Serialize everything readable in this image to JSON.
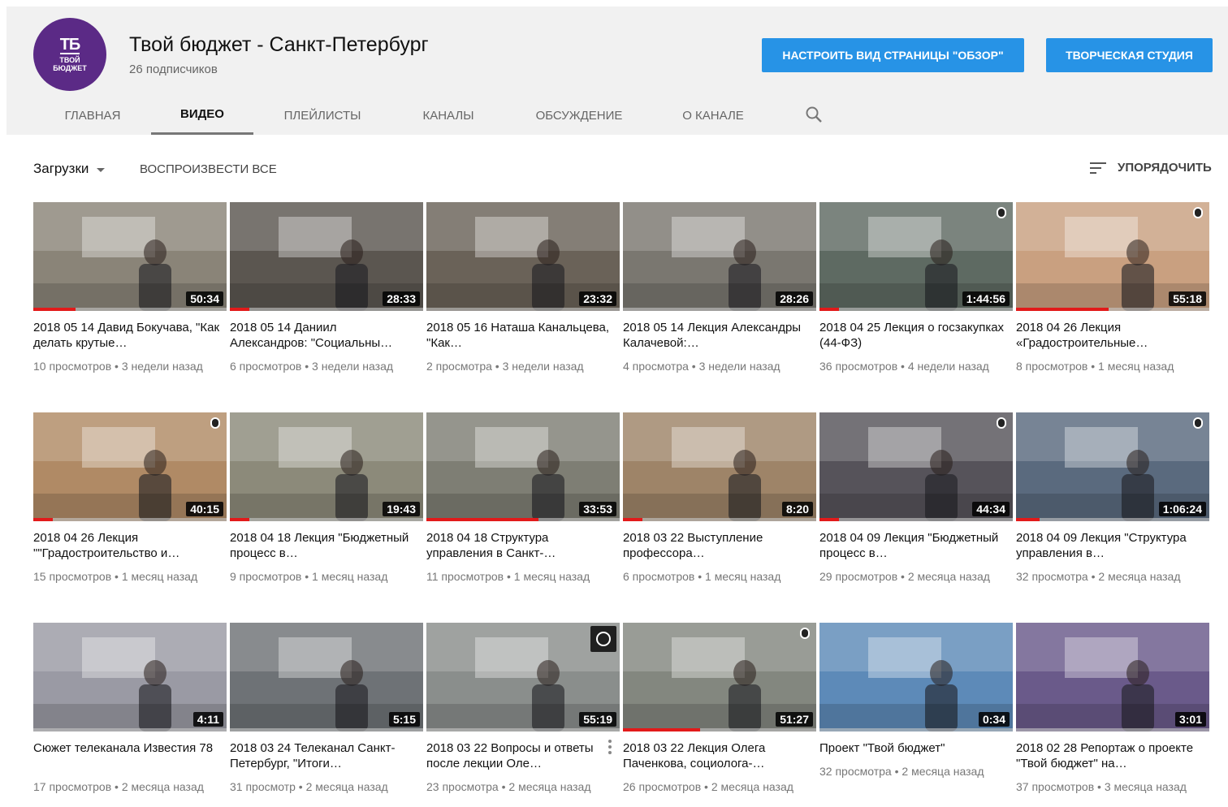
{
  "channel": {
    "title": "Твой бюджет - Санкт-Петербург",
    "subscribers": "26 подписчиков",
    "logo_line1": "TБ",
    "logo_line2": "ТВОЙ",
    "logo_line3": "БЮДЖЕТ",
    "customize_label": "НАСТРОИТЬ ВИД СТРАНИЦЫ \"ОБЗОР\"",
    "studio_label": "ТВОРЧЕСКАЯ СТУДИЯ"
  },
  "tabs": [
    {
      "label": "ГЛАВНАЯ"
    },
    {
      "label": "ВИДЕО"
    },
    {
      "label": "ПЛЕЙЛИСТЫ"
    },
    {
      "label": "КАНАЛЫ"
    },
    {
      "label": "ОБСУЖДЕНИЕ"
    },
    {
      "label": "О КАНАЛЕ"
    }
  ],
  "toolbar": {
    "uploads_label": "Загрузки",
    "play_all_label": "ВОСПРОИЗВЕСТИ ВСЕ",
    "sort_label": "УПОРЯДОЧИТЬ"
  },
  "colors": {
    "accent": "#2793e6",
    "progress": "#e21a1a",
    "brand": "#5b2a86"
  },
  "videos": [
    {
      "title": "2018 05 14 Давид Бокучава, \"Как делать крутые…",
      "duration": "50:34",
      "views": "10 просмотров",
      "age": "3 недели назад",
      "progress": 0.22,
      "bg": "#8a8478",
      "icon": ""
    },
    {
      "title": "2018 05 14 Даниил Александров: \"Социальны…",
      "duration": "28:33",
      "views": "6 просмотров",
      "age": "3 недели назад",
      "progress": 0.1,
      "bg": "#5b5650",
      "icon": ""
    },
    {
      "title": "2018 05 16 Наташа Канальцева, \"Как…",
      "duration": "23:32",
      "views": "2 просмотра",
      "age": "3 недели назад",
      "progress": 0,
      "bg": "#6a6258",
      "icon": ""
    },
    {
      "title": "2018 05 14 Лекция Александры Калачевой:…",
      "duration": "28:26",
      "views": "4 просмотра",
      "age": "3 недели назад",
      "progress": 0,
      "bg": "#7a7770",
      "icon": ""
    },
    {
      "title": "2018 04 25 Лекция о госзакупках (44-ФЗ)",
      "duration": "1:44:56",
      "views": "36 просмотров",
      "age": "4 недели назад",
      "progress": 0.1,
      "bg": "#5e6a62",
      "icon": "overlay"
    },
    {
      "title": "2018 04 26 Лекция «Градостроительные…",
      "duration": "55:18",
      "views": "8 просмотров",
      "age": "1 месяц назад",
      "progress": 0.48,
      "bg": "#c9a080",
      "icon": "overlay"
    },
    {
      "title": "2018 04 26 Лекция \"\"Градостроительство и…",
      "duration": "40:15",
      "views": "15 просмотров",
      "age": "1 месяц назад",
      "progress": 0.1,
      "bg": "#b08a65",
      "icon": "overlay"
    },
    {
      "title": "2018 04 18 Лекция \"Бюджетный процесс в…",
      "duration": "19:43",
      "views": "9 просмотров",
      "age": "1 месяц назад",
      "progress": 0.1,
      "bg": "#8c8a7a",
      "icon": ""
    },
    {
      "title": "2018 04 18 Структура управления в Санкт-…",
      "duration": "33:53",
      "views": "11 просмотров",
      "age": "1 месяц назад",
      "progress": 0.58,
      "bg": "#7e7e74",
      "icon": ""
    },
    {
      "title": "2018 03 22 Выступление профессора…",
      "duration": "8:20",
      "views": "6 просмотров",
      "age": "1 месяц назад",
      "progress": 0.1,
      "bg": "#9e8468",
      "icon": ""
    },
    {
      "title": "2018 04 09 Лекция \"Бюджетный процесс в…",
      "duration": "44:34",
      "views": "29 просмотров",
      "age": "2 месяца назад",
      "progress": 0.1,
      "bg": "#56535a",
      "icon": "overlay"
    },
    {
      "title": "2018 04 09 Лекция \"Структура управления в…",
      "duration": "1:06:24",
      "views": "32 просмотра",
      "age": "2 месяца назад",
      "progress": 0.12,
      "bg": "#5a6a7e",
      "icon": "overlay"
    },
    {
      "title": "Сюжет телеканала Известия 78",
      "duration": "4:11",
      "views": "17 просмотров",
      "age": "2 месяца назад",
      "progress": 0,
      "bg": "#9a9aa4",
      "icon": ""
    },
    {
      "title": "2018 03 24 Телеканал Санкт-Петербург, \"Итоги…",
      "duration": "5:15",
      "views": "31 просмотр",
      "age": "2 месяца назад",
      "progress": 0,
      "bg": "#6e7276",
      "icon": ""
    },
    {
      "title": "2018 03 22 Вопросы и ответы после лекции Оле…",
      "duration": "55:19",
      "views": "23 просмотра",
      "age": "2 месяца назад",
      "progress": 0,
      "bg": "#8a8e8c",
      "icon": "clock",
      "kebab": true
    },
    {
      "title": "2018 03 22 Лекция Олега Паченкова, социолога-…",
      "duration": "51:27",
      "views": "26 просмотров",
      "age": "2 месяца назад",
      "progress": 0.4,
      "bg": "#83877f",
      "icon": "overlay"
    },
    {
      "title": "Проект \"Твой бюджет\"",
      "duration": "0:34",
      "views": "32 просмотра",
      "age": "2 месяца назад",
      "progress": 0,
      "bg": "#5d8ab8",
      "icon": ""
    },
    {
      "title": "2018 02 28 Репортаж о проекте \"Твой бюджет\" на…",
      "duration": "3:01",
      "views": "37 просмотров",
      "age": "3 месяца назад",
      "progress": 0,
      "bg": "#6a5a8a",
      "icon": ""
    }
  ]
}
